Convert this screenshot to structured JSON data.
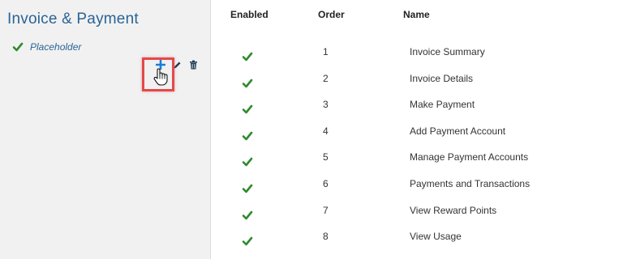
{
  "sidebar": {
    "title": "Invoice & Payment",
    "tree_item_label": "Placeholder",
    "actions": [
      "plus-icon",
      "pencil-icon",
      "trash-icon"
    ]
  },
  "table": {
    "headers": {
      "enabled": "Enabled",
      "order": "Order",
      "name": "Name"
    },
    "rows": [
      {
        "enabled": true,
        "order": "1",
        "name": "Invoice Summary"
      },
      {
        "enabled": true,
        "order": "2",
        "name": "Invoice Details"
      },
      {
        "enabled": true,
        "order": "3",
        "name": "Make Payment"
      },
      {
        "enabled": true,
        "order": "4",
        "name": "Add Payment Account"
      },
      {
        "enabled": true,
        "order": "5",
        "name": "Manage Payment Accounts"
      },
      {
        "enabled": true,
        "order": "6",
        "name": "Payments and Transactions"
      },
      {
        "enabled": true,
        "order": "7",
        "name": "View Reward Points"
      },
      {
        "enabled": true,
        "order": "8",
        "name": "View Usage"
      }
    ]
  },
  "colors": {
    "accent": "#2a6496",
    "check": "#2e8b2e",
    "plus": "#1a7fd6",
    "highlight": "#e24a4a"
  }
}
